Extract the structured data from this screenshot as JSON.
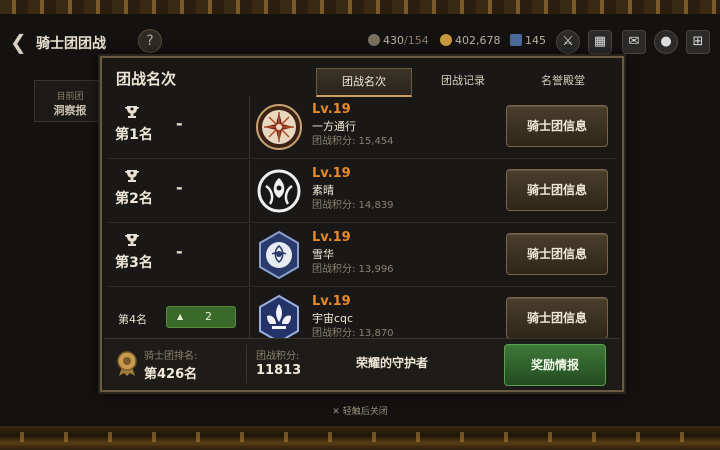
{
  "topbar": {
    "back_glyph": "❮",
    "title": "骑士团团战",
    "help": "?",
    "res1_value": "430",
    "res1_max": "/154",
    "res2_value": "402,678",
    "res3_value": "145"
  },
  "side_tab": {
    "line1": "目前团",
    "line2": "洞察报"
  },
  "panel": {
    "title": "团战名次",
    "tabs": [
      "团战名次",
      "团战记录",
      "名誉殿堂"
    ]
  },
  "rows": [
    {
      "rank": "第1名",
      "change": "-",
      "level": "Lv.19",
      "guild": "一方通行",
      "score": "团战积分: 15,454",
      "button": "骑士团信息"
    },
    {
      "rank": "第2名",
      "change": "-",
      "level": "Lv.19",
      "guild": "素晴",
      "score": "团战积分: 14,839",
      "button": "骑士团信息"
    },
    {
      "rank": "第3名",
      "change": "-",
      "level": "Lv.19",
      "guild": "雪华",
      "score": "团战积分: 13,996",
      "button": "骑士团信息"
    },
    {
      "rank": "第4名",
      "change": "2",
      "level": "Lv.19",
      "guild": "宇宙cqc",
      "score": "团战积分: 13,870",
      "button": "骑士团信息"
    }
  ],
  "bottom": {
    "rank_label": "骑士团排名:",
    "rank_value": "第426名",
    "score_label": "团战积分:",
    "score_value": "11813",
    "honor_title": "荣耀的守护者",
    "reward_button": "奖励情报"
  },
  "close_hint": "✕ 轻触后关闭",
  "colors": {
    "accent_gold": "#c8a060",
    "level_orange": "#e88a28",
    "reward_green": "#3e7a38"
  }
}
